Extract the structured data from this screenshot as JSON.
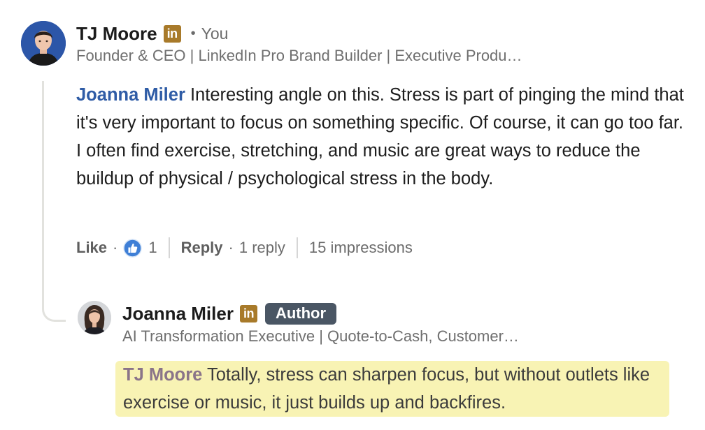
{
  "comment": {
    "author_name": "TJ Moore",
    "linkedin_badge": "in",
    "relation_label": "You",
    "headline": "Founder & CEO | LinkedIn Pro Brand Builder | Executive Produ…",
    "mention": "Joanna Miler",
    "text": " Interesting angle on this. Stress is part of pinging the mind that it's very important to focus on something specific. Of course, it can go too far. I often find exercise, stretching, and music are great ways to reduce the buildup of physical / psychological stress in the body.",
    "actions": {
      "like_label": "Like",
      "reaction_count": "1",
      "reply_label": "Reply",
      "reply_count_label": "1 reply",
      "impressions_label": "15 impressions"
    }
  },
  "reply": {
    "author_name": "Joanna Miler",
    "linkedin_badge": "in",
    "author_badge": "Author",
    "headline": "AI Transformation Executive | Quote-to-Cash, Customer…",
    "mention": "TJ Moore",
    "text": " Totally, stress can sharpen focus, but without outlets like exercise or music, it just builds up and backfires."
  },
  "icons": {
    "like": "like-thumbs-up-icon",
    "linkedin": "linkedin-icon"
  },
  "colors": {
    "mention_blue": "#2f5ca6",
    "linkedin_badge": "#a87a2a",
    "author_pill": "#4a5664",
    "highlight": "#f8f3b4",
    "like_blue": "#3f7fd6"
  }
}
